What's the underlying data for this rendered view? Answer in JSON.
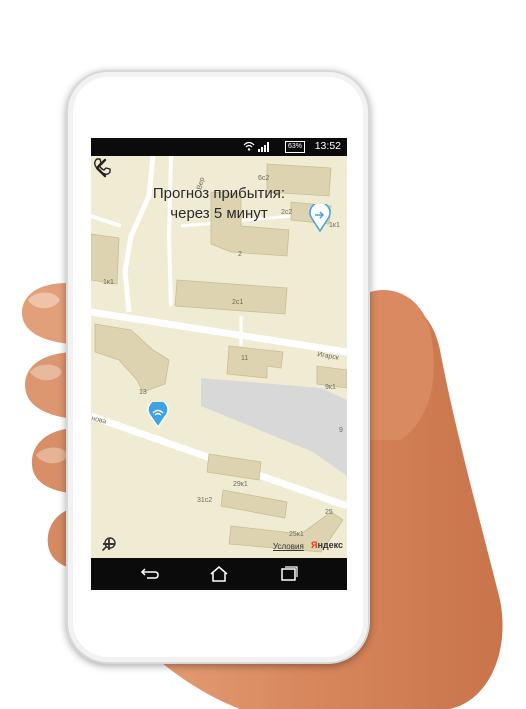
{
  "status_bar": {
    "battery": "63%",
    "time": "13:52"
  },
  "header": {
    "eta_line1": "Прогноз прибытия:",
    "eta_line2": "через 5 минут"
  },
  "map": {
    "street_labels": [
      "Игарск",
      "Вер",
      "нова"
    ],
    "house_numbers": [
      "6с2",
      "2с2",
      "1к1",
      "2",
      "1к1",
      "2с1",
      "11",
      "9к1",
      "13",
      "9",
      "29к1",
      "31с2",
      "25к1",
      "25"
    ],
    "terms_link": "Условия",
    "provider_logo_first": "Я",
    "provider_logo_rest": "ндекс"
  },
  "colors": {
    "map_background": "#f0ebd3",
    "building": "#ddd3b0",
    "pin": "#3fa3e3"
  },
  "icons": [
    "back-arrow-icon",
    "phone-icon",
    "wifi-icon",
    "signal-icon",
    "battery-icon",
    "driver-pin-icon",
    "destination-pin-icon",
    "search-icon",
    "zoom-out-icon",
    "zoom-in-icon",
    "nav-back-icon",
    "nav-home-icon",
    "nav-recents-icon"
  ]
}
